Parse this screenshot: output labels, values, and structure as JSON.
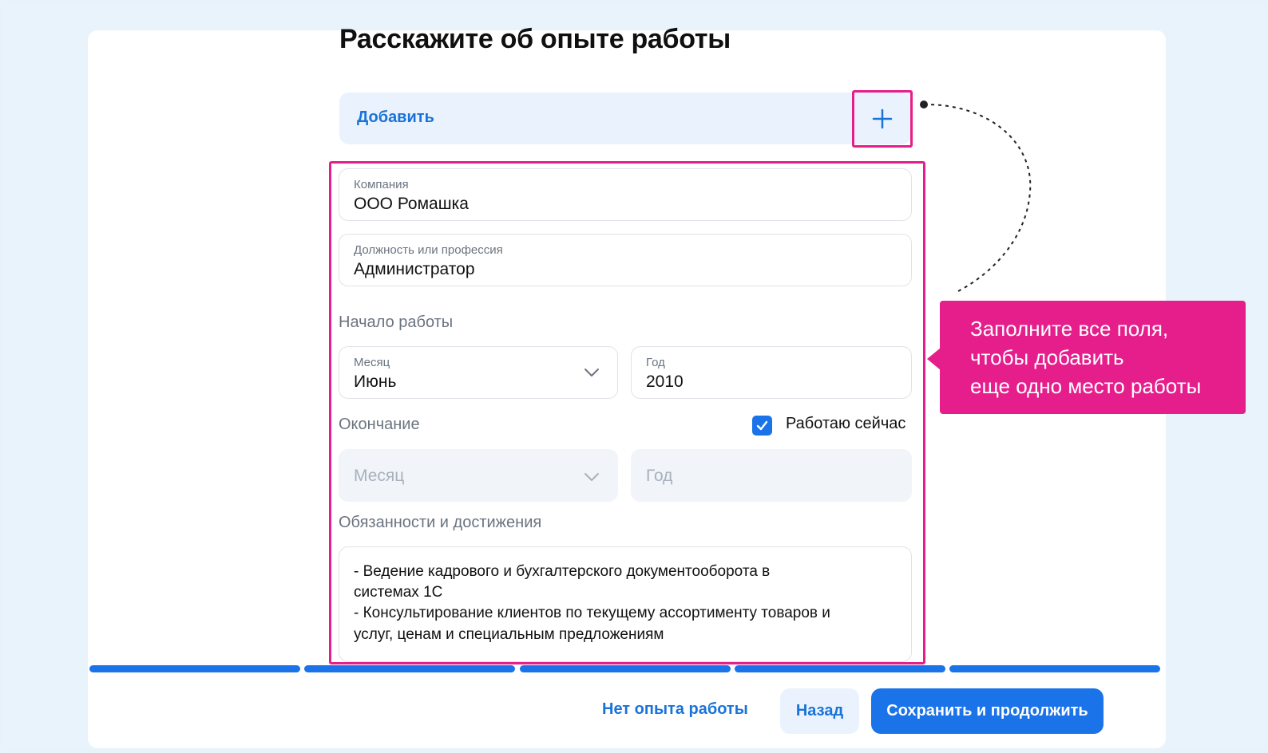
{
  "page": {
    "title": "Расскажите об опыте работы"
  },
  "add_section": {
    "label": "Добавить",
    "plus_icon": "plus-icon"
  },
  "form": {
    "company": {
      "label": "Компания",
      "value": "ООО Ромашка"
    },
    "position": {
      "label": "Должность или профессия",
      "value": "Администратор"
    },
    "start": {
      "heading": "Начало работы",
      "month": {
        "label": "Месяц",
        "value": "Июнь"
      },
      "year": {
        "label": "Год",
        "value": "2010"
      }
    },
    "end": {
      "heading": "Окончание",
      "working_now_label": "Работаю сейчас",
      "working_now_checked": true,
      "month_placeholder": "Месяц",
      "year_placeholder": "Год"
    },
    "duties": {
      "heading": "Обязанности и достижения",
      "lines": [
        "- Ведение кадрового и бухгалтерского документооборота в",
        "системах 1С",
        "- Консультирование клиентов по текущему ассортименту товаров и",
        "услуг, ценам и специальным предложениям"
      ]
    }
  },
  "progress": {
    "segments_total": 5,
    "segments_filled": 5
  },
  "footer": {
    "no_experience": "Нет опыта работы",
    "back": "Назад",
    "save": "Сохранить и продолжить"
  },
  "callout": {
    "lines": [
      "Заполните все поля,",
      "чтобы добавить",
      "еще одно место работы"
    ]
  },
  "colors": {
    "accent": "#1a73e8",
    "annotation": "#e61e8c",
    "background": "#e8f2fa"
  }
}
